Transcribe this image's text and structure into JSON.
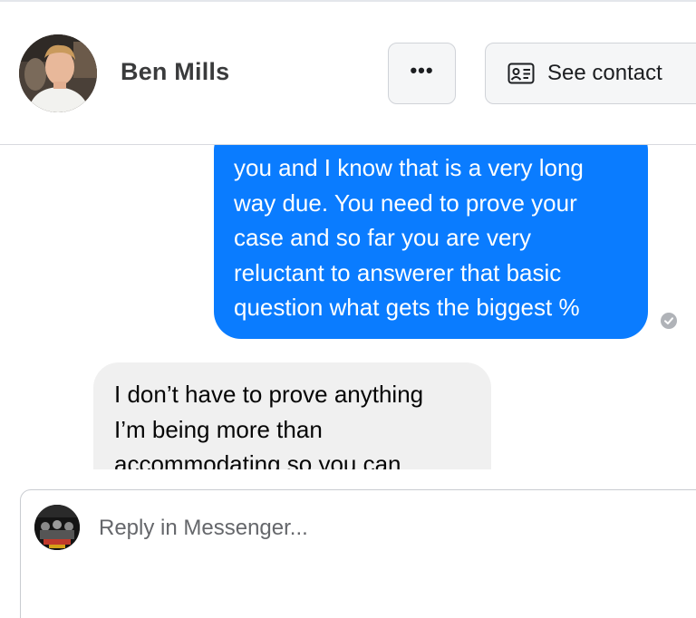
{
  "header": {
    "contact_name": "Ben Mills",
    "more_label": "•••",
    "see_contact_label": "See contact"
  },
  "thread": {
    "outgoing_lines": [
      "you and I know that is a very long",
      "way due. You need to prove your",
      "case and so far you are very",
      "reluctant to answerer that basic",
      "question what gets the biggest %"
    ],
    "incoming_lines": [
      "I don’t have to prove anything",
      "I’m being more than",
      "accommodating so you can"
    ]
  },
  "composer": {
    "placeholder": "Reply in Messenger..."
  },
  "icons": {
    "more": "more-dots-icon",
    "contact_card": "contact-card-icon",
    "seen": "seen-check-icon"
  },
  "colors": {
    "outgoing_bubble": "#0a7cff",
    "incoming_bubble": "#f0f0f0",
    "button_bg": "#f5f6f7"
  }
}
